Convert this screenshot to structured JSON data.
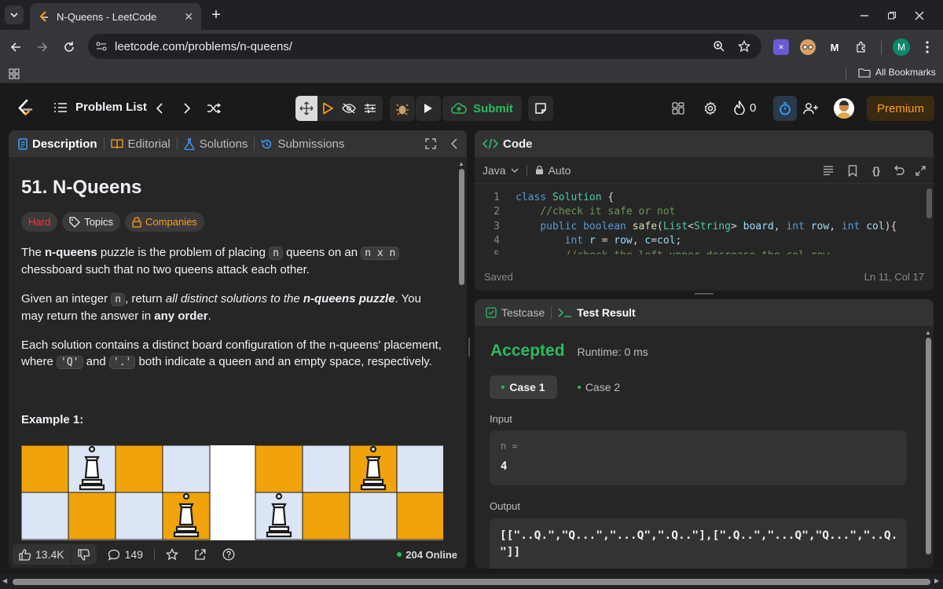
{
  "browser": {
    "tab_title": "N-Queens - LeetCode",
    "url": "leetcode.com/problems/n-queens/",
    "all_bookmarks": "All Bookmarks",
    "profile_initial": "M",
    "ext_medium": "M"
  },
  "nav": {
    "problem_list": "Problem List",
    "submit": "Submit",
    "streak": "0",
    "premium": "Premium"
  },
  "desc_tabs": [
    "Description",
    "Editorial",
    "Solutions",
    "Submissions"
  ],
  "problem": {
    "title": "51. N-Queens",
    "difficulty": "Hard",
    "topics": "Topics",
    "companies": "Companies",
    "p1_a": "The ",
    "p1_b": "n-queens",
    "p1_c": " puzzle is the problem of placing ",
    "p1_code1": "n",
    "p1_d": " queens on an ",
    "p1_code2": "n x n",
    "p1_e": " chessboard such that no two queens attack each other.",
    "p2_a": "Given an integer ",
    "p2_code": "n",
    "p2_b": ", return ",
    "p2_em": "all distinct solutions to the ",
    "p2_strong": "n-queens puzzle",
    "p2_c": ". You may return the answer in ",
    "p2_d": "any order",
    "p2_e": ".",
    "p3_a": "Each solution contains a distinct board configuration of the n-queens' placement, where ",
    "p3_code1": "'Q'",
    "p3_b": " and ",
    "p3_code2": "'.'",
    "p3_c": " both indicate a queen and an empty space, respectively.",
    "example_label": "Example 1:"
  },
  "board": {
    "colors": {
      "orange": "#f0a30a",
      "blue": "#dbe5f6",
      "queen": "#1a1a1a"
    },
    "left": [
      [
        "o",
        "bQ",
        "o",
        "b"
      ],
      [
        "b",
        "o",
        "b",
        "oQ"
      ]
    ],
    "right": [
      [
        "o",
        "b",
        "oQ",
        "b"
      ],
      [
        "bQ",
        "o",
        "b",
        "o"
      ]
    ]
  },
  "desc_footer": {
    "likes": "13.4K",
    "comments": "149",
    "online": "204 Online"
  },
  "code": {
    "header": "Code",
    "language": "Java",
    "mode": "Auto",
    "status": "Saved",
    "cursor": "Ln 11, Col 17",
    "lines": [
      {
        "n": "1",
        "tokens": [
          [
            "kw",
            "class "
          ],
          [
            "ty",
            "Solution "
          ],
          [
            "pl",
            "{"
          ]
        ]
      },
      {
        "n": "2",
        "tokens": [
          [
            "pl",
            "    "
          ],
          [
            "cm",
            "//check it safe or not"
          ]
        ]
      },
      {
        "n": "3",
        "tokens": [
          [
            "pl",
            "    "
          ],
          [
            "kw",
            "public boolean "
          ],
          [
            "fn",
            "safe"
          ],
          [
            "pl",
            "("
          ],
          [
            "ty",
            "List"
          ],
          [
            "pl",
            "<"
          ],
          [
            "ty",
            "String"
          ],
          [
            "pl",
            "> "
          ],
          [
            "vr",
            "board"
          ],
          [
            "pl",
            ", "
          ],
          [
            "kw",
            "int "
          ],
          [
            "vr",
            "row"
          ],
          [
            "pl",
            ", "
          ],
          [
            "kw",
            "int "
          ],
          [
            "vr",
            "col"
          ],
          [
            "pl",
            "){"
          ]
        ]
      },
      {
        "n": "4",
        "tokens": [
          [
            "pl",
            "        "
          ],
          [
            "kw",
            "int "
          ],
          [
            "vr",
            "r "
          ],
          [
            "pl",
            "= "
          ],
          [
            "vr",
            "row"
          ],
          [
            "pl",
            ", "
          ],
          [
            "vr",
            "c"
          ],
          [
            "pl",
            "="
          ],
          [
            "vr",
            "col"
          ],
          [
            "pl",
            ";"
          ]
        ]
      },
      {
        "n": "5",
        "tokens": [
          [
            "pl",
            "        "
          ],
          [
            "cm",
            "//check the left upper decrease the col row"
          ]
        ]
      }
    ]
  },
  "test": {
    "tab_testcase": "Testcase",
    "tab_result": "Test Result",
    "verdict": "Accepted",
    "runtime": "Runtime: 0 ms",
    "case1": "Case 1",
    "case2": "Case 2",
    "input_label": "Input",
    "input_var": "n =",
    "input_val": "4",
    "output_label": "Output",
    "output_line1": "[[\"..Q.\",\"Q...\",\"...Q\",\".Q..\"],[\".Q..\",\"...Q\",\"Q...\",\"..Q.",
    "output_line2": "\"]]"
  }
}
